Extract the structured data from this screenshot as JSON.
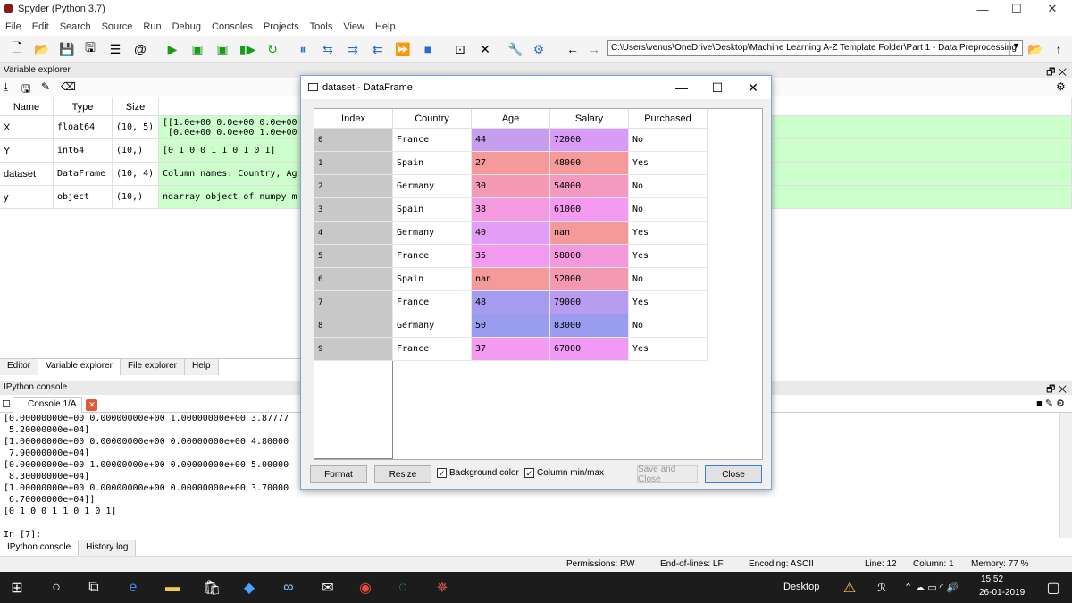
{
  "window": {
    "title": "Spyder (Python 3.7)",
    "min": "—",
    "max": "☐",
    "close": "✕"
  },
  "menu": [
    "File",
    "Edit",
    "Search",
    "Source",
    "Run",
    "Debug",
    "Consoles",
    "Projects",
    "Tools",
    "View",
    "Help"
  ],
  "path": "C:\\Users\\venus\\OneDrive\\Desktop\\Machine Learning A-Z Template Folder\\Part 1 - Data Preprocessing",
  "variable_explorer": {
    "title": "Variable explorer",
    "headers": [
      "Name",
      "Type",
      "Size",
      ""
    ],
    "rows": [
      {
        "name": "X",
        "type": "float64",
        "size": "(10, 5)",
        "value": "[[1.0e+00 0.0e+00 0.0e+00\n [0.0e+00 0.0e+00 1.0e+00"
      },
      {
        "name": "Y",
        "type": "int64",
        "size": "(10,)",
        "value": "[0 1 0 0 1 1 0 1 0 1]"
      },
      {
        "name": "dataset",
        "type": "DataFrame",
        "size": "(10, 4)",
        "value": "Column names: Country, Ag"
      },
      {
        "name": "y",
        "type": "object",
        "size": "(10,)",
        "value": "ndarray object of numpy m"
      }
    ]
  },
  "pane_tabs": [
    "Editor",
    "Variable explorer",
    "File explorer",
    "Help"
  ],
  "ipython": {
    "title": "IPython console",
    "tab": "Console 1/A",
    "text": "[0.00000000e+00 0.00000000e+00 1.00000000e+00 3.87777\n 5.20000000e+04]\n[1.00000000e+00 0.00000000e+00 0.00000000e+00 4.80000\n 7.90000000e+04]\n[0.00000000e+00 1.00000000e+00 0.00000000e+00 5.00000\n 8.30000000e+04]\n[1.00000000e+00 0.00000000e+00 0.00000000e+00 3.70000\n 6.70000000e+04]]\n[0 1 0 0 1 1 0 1 0 1]\n\nIn [7]:",
    "bottom_tabs": [
      "IPython console",
      "History log"
    ]
  },
  "status": {
    "permissions": "Permissions:  RW",
    "eol": "End-of-lines:  LF",
    "encoding": "Encoding:  ASCII",
    "line": "Line:  12",
    "column": "Column:  1",
    "memory": "Memory:  77 %"
  },
  "taskbar": {
    "desktop": "Desktop",
    "time": "15:52",
    "date": "26-01-2019"
  },
  "dialog": {
    "title": "dataset - DataFrame",
    "headers": [
      "Index",
      "Country",
      "Age",
      "Salary",
      "Purchased"
    ],
    "rows": [
      {
        "idx": "0",
        "country": "France",
        "age": "44",
        "salary": "72000",
        "purchased": "No"
      },
      {
        "idx": "1",
        "country": "Spain",
        "age": "27",
        "salary": "48000",
        "purchased": "Yes"
      },
      {
        "idx": "2",
        "country": "Germany",
        "age": "30",
        "salary": "54000",
        "purchased": "No"
      },
      {
        "idx": "3",
        "country": "Spain",
        "age": "38",
        "salary": "61000",
        "purchased": "No"
      },
      {
        "idx": "4",
        "country": "Germany",
        "age": "40",
        "salary": "nan",
        "purchased": "Yes"
      },
      {
        "idx": "5",
        "country": "France",
        "age": "35",
        "salary": "58000",
        "purchased": "Yes"
      },
      {
        "idx": "6",
        "country": "Spain",
        "age": "nan",
        "salary": "52000",
        "purchased": "No"
      },
      {
        "idx": "7",
        "country": "France",
        "age": "48",
        "salary": "79000",
        "purchased": "Yes"
      },
      {
        "idx": "8",
        "country": "Germany",
        "age": "50",
        "salary": "83000",
        "purchased": "No"
      },
      {
        "idx": "9",
        "country": "France",
        "age": "37",
        "salary": "67000",
        "purchased": "Yes"
      }
    ],
    "age_colors": [
      "#c79df0",
      "#f49a9a",
      "#f49ab6",
      "#f49ae0",
      "#e39df6",
      "#f49af0",
      "#f49a9a",
      "#a59cf0",
      "#9a9cf0",
      "#f49af0"
    ],
    "salary_colors": [
      "#d99cf6",
      "#f49a9a",
      "#f49ac0",
      "#f49af0",
      "#f49a9a",
      "#f49adc",
      "#f49ab0",
      "#b89cf0",
      "#9a9cf0",
      "#f09af4"
    ],
    "buttons": {
      "format": "Format",
      "resize": "Resize",
      "bg": "Background color",
      "minmax": "Column min/max",
      "save": "Save and Close",
      "close": "Close"
    }
  }
}
